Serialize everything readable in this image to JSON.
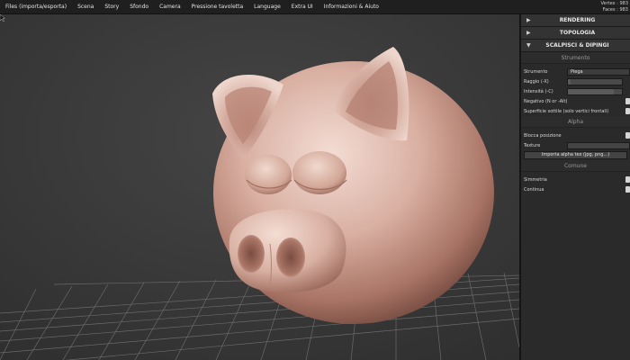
{
  "menu": {
    "items": [
      "Files (importa/esporta)",
      "Scena",
      "Story",
      "Sfondo",
      "Camera",
      "Pressione tavoletta",
      "Language",
      "Extra UI",
      "Informazioni & Aiuto"
    ]
  },
  "stats": {
    "vertex": "Vertex : 983",
    "faces": "Faces : 983"
  },
  "panel": {
    "sections": {
      "rendering": "RENDERING",
      "topologia": "TOPOLOGIA",
      "sculpt": "SCALPISCI & DIPINGI"
    },
    "strumento_group": "Strumento",
    "strumento_label": "Strumento",
    "strumento_value": "Piega",
    "raggio_label": "Raggio (-X)",
    "intensita_label": "Intensità (-C)",
    "negativo_label": "Negativo (N or -Alt)",
    "superficie_label": "Superficie sottile (solo vertici frontali)",
    "alpha_group": "Alpha",
    "blocca_label": "Blocca posizione",
    "texture_label": "Texture",
    "importa_button": "Importa alpha tex (jpg, png...)",
    "comune_group": "Comune",
    "simmetria_label": "Simmetria",
    "continua_label": "Continua",
    "raggio_fraction": 0.05,
    "intensita_fraction": 0.85
  }
}
